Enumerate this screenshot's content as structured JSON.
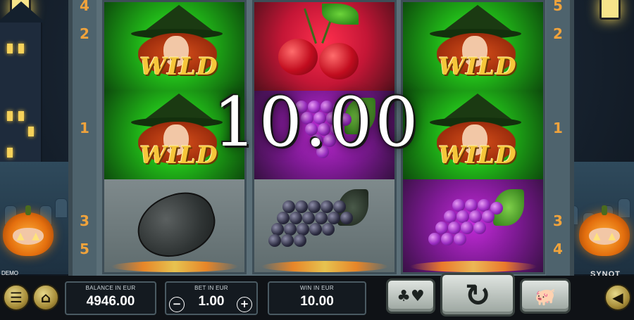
{
  "game": {
    "win_amount": "10.00",
    "demo_label": "DEMO",
    "brand": "SYNOT"
  },
  "paylines": {
    "left": [
      "4",
      "2",
      "1",
      "3",
      "5"
    ],
    "right": [
      "5",
      "2",
      "1",
      "3",
      "4"
    ]
  },
  "reels": [
    {
      "symbols": [
        "wild",
        "wild",
        "lemon"
      ],
      "wild_text": "WILD"
    },
    {
      "symbols": [
        "cherries",
        "grapes",
        "grapes"
      ]
    },
    {
      "symbols": [
        "wild",
        "wild",
        "grapes"
      ],
      "wild_text": "WILD"
    }
  ],
  "panels": {
    "balance": {
      "label": "BALANCE IN EUR",
      "value": "4946.00"
    },
    "bet": {
      "label": "BET IN EUR",
      "value": "1.00",
      "minus": "−",
      "plus": "+"
    },
    "win": {
      "label": "WIN IN EUR",
      "value": "10.00"
    }
  },
  "buttons": {
    "menu_icon": "menu-icon",
    "home_icon": "home-icon",
    "gamble_icon": "cards-icon",
    "spin_icon": "spin-icon",
    "autoplay_icon": "piggy-bank-icon",
    "sound_icon": "sound-icon"
  },
  "colors": {
    "wild_glow": "#1fae17",
    "cherry_glow": "#c41636",
    "grape_glow": "#7d1a93",
    "payline_number": "#f0a33c"
  }
}
